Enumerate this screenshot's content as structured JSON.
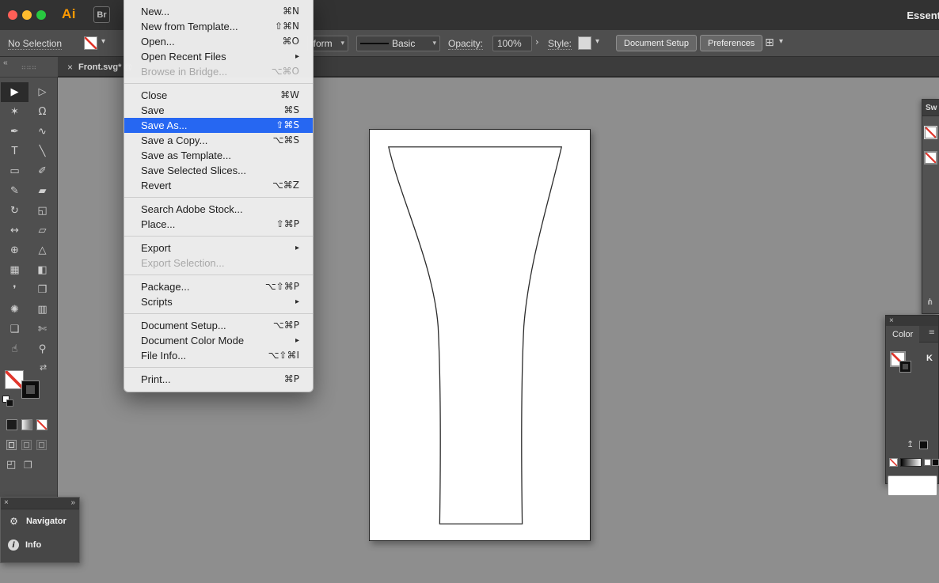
{
  "colors": {
    "accent_blue": "#2667f2",
    "titlebar_bg": "#323232",
    "controlbar_bg": "#4e4e4e",
    "panel_bg": "#4a4a4a",
    "canvas_bg": "#8e8e8e",
    "menu_bg": "#ededed",
    "none_slash_red": "#e0352b",
    "traffic_red": "#ff5f57",
    "traffic_yellow": "#febc2e",
    "traffic_green": "#28c840",
    "ai_orange": "#ff9a00"
  },
  "icons": {
    "chevron_down": "▾",
    "dropdown_next": "›",
    "submenu_arrow": "▸",
    "swap_arrows": "⇄",
    "collapse_left": "‹‹",
    "grip_dots": "⠶⠶⠶",
    "grid": "⊞",
    "close": "×",
    "expand_right": "»",
    "library": "⋔",
    "up_arrow": "↥",
    "panel_menu": "≡",
    "screen_mode": "◰",
    "windows": "❐"
  },
  "titlebar": {
    "ai_logo": "Ai",
    "br_logo": "Br",
    "workspace": "Essent"
  },
  "controlbar": {
    "selection_status": "No Selection",
    "width_profile": "iform",
    "brush": "Basic",
    "opacity_label": "Opacity:",
    "opacity_value": "100%",
    "style_label": "Style:",
    "document_setup_button": "Document Setup",
    "preferences_button": "Preferences"
  },
  "tabbar": {
    "close": "×",
    "title": "Front.svg* @"
  },
  "file_menu": {
    "groups": [
      {
        "items": [
          {
            "label": "New...",
            "shortcut": "⌘N"
          },
          {
            "label": "New from Template...",
            "shortcut": "⇧⌘N"
          },
          {
            "label": "Open...",
            "shortcut": "⌘O"
          },
          {
            "label": "Open Recent Files",
            "submenu": true
          },
          {
            "label": "Browse in Bridge...",
            "shortcut": "⌥⌘O",
            "disabled": true
          }
        ]
      },
      {
        "items": [
          {
            "label": "Close",
            "shortcut": "⌘W"
          },
          {
            "label": "Save",
            "shortcut": "⌘S"
          },
          {
            "label": "Save As...",
            "shortcut": "⇧⌘S",
            "highlighted": true
          },
          {
            "label": "Save a Copy...",
            "shortcut": "⌥⌘S"
          },
          {
            "label": "Save as Template..."
          },
          {
            "label": "Save Selected Slices..."
          },
          {
            "label": "Revert",
            "shortcut": "⌥⌘Z"
          }
        ]
      },
      {
        "items": [
          {
            "label": "Search Adobe Stock..."
          },
          {
            "label": "Place...",
            "shortcut": "⇧⌘P"
          }
        ]
      },
      {
        "items": [
          {
            "label": "Export",
            "submenu": true
          },
          {
            "label": "Export Selection...",
            "disabled": true
          }
        ]
      },
      {
        "items": [
          {
            "label": "Package...",
            "shortcut": "⌥⇧⌘P"
          },
          {
            "label": "Scripts",
            "submenu": true
          }
        ]
      },
      {
        "items": [
          {
            "label": "Document Setup...",
            "shortcut": "⌥⌘P"
          },
          {
            "label": "Document Color Mode",
            "submenu": true
          },
          {
            "label": "File Info...",
            "shortcut": "⌥⇧⌘I"
          }
        ]
      },
      {
        "items": [
          {
            "label": "Print...",
            "shortcut": "⌘P"
          }
        ]
      }
    ]
  },
  "toolbar": {
    "tools": [
      {
        "name": "selection-tool",
        "glyph": "▶",
        "active": true
      },
      {
        "name": "direct-selection-tool",
        "glyph": "▷"
      },
      {
        "name": "magic-wand-tool",
        "glyph": "✶"
      },
      {
        "name": "lasso-tool",
        "glyph": "Ω"
      },
      {
        "name": "pen-tool",
        "glyph": "✒"
      },
      {
        "name": "curvature-tool",
        "glyph": "∿"
      },
      {
        "name": "type-tool",
        "glyph": "T"
      },
      {
        "name": "line-segment-tool",
        "glyph": "╲"
      },
      {
        "name": "rectangle-tool",
        "glyph": "▭"
      },
      {
        "name": "paintbrush-tool",
        "glyph": "✐"
      },
      {
        "name": "pencil-tool",
        "glyph": "✎"
      },
      {
        "name": "eraser-tool",
        "glyph": "▰"
      },
      {
        "name": "rotate-tool",
        "glyph": "↻"
      },
      {
        "name": "scale-tool",
        "glyph": "◱"
      },
      {
        "name": "width-tool",
        "glyph": "↔"
      },
      {
        "name": "free-transform-tool",
        "glyph": "▱"
      },
      {
        "name": "shape-builder-tool",
        "glyph": "⊕"
      },
      {
        "name": "perspective-grid-tool",
        "glyph": "△"
      },
      {
        "name": "mesh-tool",
        "glyph": "▦"
      },
      {
        "name": "gradient-tool",
        "glyph": "◧"
      },
      {
        "name": "eyedropper-tool",
        "glyph": "❜"
      },
      {
        "name": "blend-tool",
        "glyph": "❒"
      },
      {
        "name": "symbol-sprayer-tool",
        "glyph": "✺"
      },
      {
        "name": "column-graph-tool",
        "glyph": "▥"
      },
      {
        "name": "artboard-tool",
        "glyph": "❑"
      },
      {
        "name": "slice-tool",
        "glyph": "✄"
      },
      {
        "name": "hand-tool",
        "glyph": "☝"
      },
      {
        "name": "zoom-tool",
        "glyph": "⚲"
      }
    ]
  },
  "swatches_panel": {
    "tab": "Sw"
  },
  "color_panel": {
    "close": "×",
    "tab": "Color",
    "channel": "K"
  },
  "navigator_panel": {
    "close": "×",
    "expand": "»",
    "items": [
      {
        "icon": "gear-icon",
        "glyph": "⚙",
        "label": "Navigator"
      },
      {
        "icon": "info-icon",
        "glyph": "i",
        "label": "Info"
      }
    ]
  }
}
